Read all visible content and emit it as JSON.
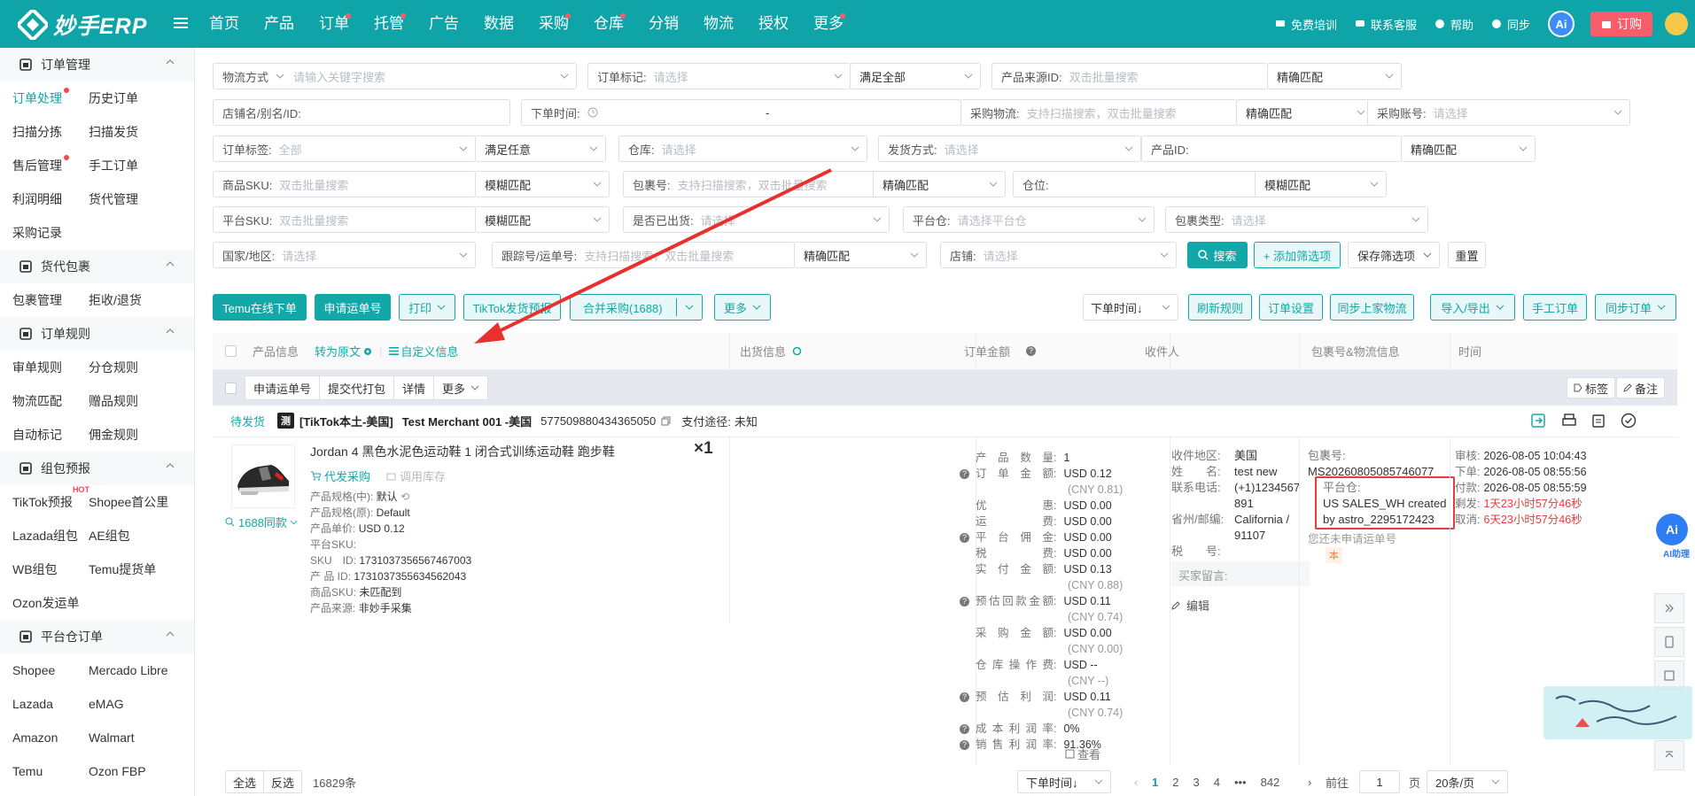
{
  "header": {
    "logo_text": "妙手ERP",
    "nav": [
      {
        "label": "首页",
        "dot": false
      },
      {
        "label": "产品",
        "dot": false
      },
      {
        "label": "订单",
        "dot": true
      },
      {
        "label": "托管",
        "dot": true
      },
      {
        "label": "广告",
        "dot": false
      },
      {
        "label": "数据",
        "dot": false
      },
      {
        "label": "采购",
        "dot": true
      },
      {
        "label": "仓库",
        "dot": true
      },
      {
        "label": "分销",
        "dot": false
      },
      {
        "label": "物流",
        "dot": false
      },
      {
        "label": "授权",
        "dot": false
      },
      {
        "label": "更多",
        "dot": true
      }
    ],
    "right": {
      "training": "免费培训",
      "service": "联系客服",
      "help": "帮助",
      "sync": "同步",
      "ai": "Ai",
      "order": "订购"
    }
  },
  "sidebar": {
    "sections": [
      {
        "title": "订单管理",
        "rows": [
          [
            "订单处理",
            "历史订单"
          ],
          [
            "扫描分拣",
            "扫描发货"
          ],
          [
            "售后管理",
            "手工订单"
          ],
          [
            "利润明细",
            "货代管理"
          ],
          [
            "采购记录",
            ""
          ]
        ]
      },
      {
        "title": "货代包裹",
        "rows": [
          [
            "包裹管理",
            "拒收/退货"
          ]
        ]
      },
      {
        "title": "订单规则",
        "rows": [
          [
            "审单规则",
            "分仓规则"
          ],
          [
            "物流匹配",
            "赠品规则"
          ],
          [
            "自动标记",
            "佣金规则"
          ]
        ]
      },
      {
        "title": "组包预报",
        "rows": [
          [
            "TikTok预报",
            "Shopee首公里"
          ],
          [
            "Lazada组包",
            "AE组包"
          ],
          [
            "WB组包",
            "Temu提货单"
          ],
          [
            "Ozon发运单",
            ""
          ]
        ]
      },
      {
        "title": "平台仓订单",
        "rows": [
          [
            "Shopee",
            "Mercado Libre"
          ],
          [
            "Lazada",
            "eMAG"
          ],
          [
            "Amazon",
            "Walmart"
          ],
          [
            "Temu",
            "Ozon FBP"
          ]
        ]
      }
    ],
    "hot_label": "HOT"
  },
  "filters": {
    "logistics_label": "物流方式",
    "logistics_ph": "请输入关键字搜索",
    "order_mark_label": "订单标记:",
    "order_mark_ph": "请选择",
    "satisfy_all": "满足全部",
    "product_src_label": "产品来源ID:",
    "batch_search_ph": "双击批量搜索",
    "exact": "精确匹配",
    "shop_alias_label": "店铺名/别名/ID:",
    "order_time_label": "下单时间:",
    "dash": "-",
    "purchase_logistics_label": "采购物流:",
    "purchase_logistics_ph": "支持扫描搜索，双击批量搜索",
    "purchase_account_label": "采购账号:",
    "select_ph": "请选择",
    "order_tag_label": "订单标签:",
    "all": "全部",
    "satisfy_any": "满足任意",
    "warehouse_label": "仓库:",
    "ship_method_label": "发货方式:",
    "product_id_label": "产品ID:",
    "sku_label": "商品SKU:",
    "fuzzy": "模糊匹配",
    "package_no_label": "包裹号:",
    "location_label": "仓位:",
    "platform_sku_label": "平台SKU:",
    "shipped_label": "是否已出货:",
    "platform_wh_label": "平台仓:",
    "platform_wh_ph": "请选择平台仓",
    "package_type_label": "包裹类型:",
    "country_label": "国家/地区:",
    "tracking_label": "跟踪号/运单号:",
    "tracking_ph": "支持扫描搜索，双击批量搜索",
    "store_label": "店铺:",
    "search_btn": "搜索",
    "add_filter_btn": "+ 添加筛选项",
    "save_filter_btn": "保存筛选项",
    "reset_btn": "重置"
  },
  "toolbar": {
    "temu_online": "Temu在线下单",
    "apply_tracking": "申请运单号",
    "print": "打印",
    "tiktok_report": "TikTok发货预报",
    "merge_purchase": "合并采购(1688)",
    "more": "更多",
    "sort_time": "下单时间↓",
    "refresh_rules": "刷新规则",
    "order_settings": "订单设置",
    "sync_logistics": "同步上家物流",
    "import_export": "导入/导出",
    "manual_order": "手工订单",
    "sync_orders": "同步订单"
  },
  "table": {
    "headers": {
      "product": "产品信息",
      "to_original": "转为原文",
      "custom_info": "自定义信息",
      "ship_info": "出货信息",
      "amount": "订单金额",
      "recipient": "收件人",
      "package": "包裹号&物流信息",
      "time": "时间"
    },
    "bulk": {
      "apply": "申请运单号",
      "submit": "提交代打包",
      "detail": "详情",
      "more": "更多",
      "tag": "标签",
      "note": "备注"
    }
  },
  "order": {
    "status": "待发货",
    "test_badge": "测",
    "store": "[TikTok本土-美国]",
    "merchant": "Test Merchant 001 -美国",
    "order_no": "577509880434365050",
    "pay_label": "支付途径:",
    "pay_value": "未知",
    "product_title": "Jordan 4 黑色水泥色运动鞋 1 闭合式训练运动鞋 跑步鞋",
    "qty": "×1",
    "proxy_purchase": "代发采购",
    "use_stock": "调用库存",
    "same_1688": "1688同款",
    "spec_cn_label": "产品规格(中):",
    "spec_cn": "默认",
    "spec_orig_label": "产品规格(原):",
    "spec_orig": "Default",
    "unit_price_label": "产品单价:",
    "unit_price": "USD 0.12",
    "platform_sku_label": "平台SKU:",
    "sku_id_label": "SKU　ID:",
    "sku_id": "1731037356567467003",
    "product_id_label": "产 品 ID:",
    "product_id": "1731037355634562043",
    "goods_sku_label": "商品SKU:",
    "goods_sku": "未匹配到",
    "source_label": "产品来源:",
    "source": "非妙手采集",
    "amounts": [
      {
        "k": "产品数量",
        "v": "1",
        "q": false,
        "sub": ""
      },
      {
        "k": "订单金额",
        "v": "USD 0.12",
        "q": true,
        "sub": "(CNY 0.81)"
      },
      {
        "k": "优惠",
        "v": "USD 0.00",
        "q": false,
        "sub": ""
      },
      {
        "k": "运费",
        "v": "USD 0.00",
        "q": false,
        "sub": ""
      },
      {
        "k": "平台佣金",
        "v": "USD 0.00",
        "q": true,
        "sub": ""
      },
      {
        "k": "税费",
        "v": "USD 0.00",
        "q": false,
        "sub": ""
      },
      {
        "k": "实付金额",
        "v": "USD 0.13",
        "q": false,
        "sub": "(CNY 0.88)"
      },
      {
        "k": "预估回款金额",
        "v": "USD 0.11",
        "q": true,
        "sub": "(CNY 0.74)"
      },
      {
        "k": "采购金额",
        "v": "USD 0.00",
        "q": false,
        "sub": "(CNY 0.00)"
      },
      {
        "k": "仓库操作费",
        "v": "USD --",
        "q": false,
        "sub": "(CNY --)"
      },
      {
        "k": "预估利润",
        "v": "USD 0.11",
        "q": true,
        "sub": "(CNY 0.74)"
      },
      {
        "k": "成本利润率",
        "v": "0%",
        "q": true,
        "sub": ""
      },
      {
        "k": "销售利润率",
        "v": "91.36%",
        "q": true,
        "sub": ""
      }
    ],
    "view": "查看",
    "recipient": {
      "region_label": "收件地区:",
      "region": "美国",
      "name_label": "姓　　名:",
      "name": "test new",
      "phone_label": "联系电话:",
      "phone": "(+1)1234567891",
      "state_label": "省州/邮编:",
      "state": "California / 91107",
      "tax_label": "税　　号:",
      "buyer_msg_label": "买家留言:",
      "edit": "编辑"
    },
    "package": {
      "pkg_label": "包裹号:",
      "pkg_no": "MS20260805085746077",
      "wh_label": "平台仓:",
      "wh_value": "US SALES_WH created by astro_2295172423",
      "not_applied": "您还未申请运单号",
      "tag": "本"
    },
    "times": [
      {
        "k": "审核:",
        "v": "2026-08-05 10:04:43",
        "red": false
      },
      {
        "k": "下单:",
        "v": "2026-08-05 08:55:56",
        "red": false
      },
      {
        "k": "付款:",
        "v": "2026-08-05 08:55:59",
        "red": false
      },
      {
        "k": "剩发:",
        "v": "1天23小时57分46秒",
        "red": true
      },
      {
        "k": "取消:",
        "v": "6天23小时57分46秒",
        "red": true
      }
    ]
  },
  "footer": {
    "select_all": "全选",
    "invert": "反选",
    "count": "16829条",
    "sort": "下单时间↓",
    "pages": [
      "1",
      "2",
      "3",
      "4",
      "•••",
      "842"
    ],
    "goto": "前往",
    "page_val": "1",
    "page_unit": "页",
    "per_page": "20条/页"
  },
  "float": {
    "ai_help": "AI助理"
  },
  "colors": {
    "brand": "#0fa5a8",
    "accent_red": "#e93b3b",
    "arrow_red": "#e8312c"
  }
}
